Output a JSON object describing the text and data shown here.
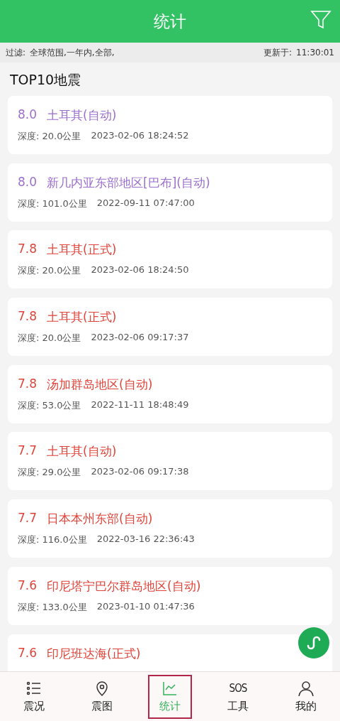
{
  "header": {
    "title": "统计"
  },
  "filter_bar": {
    "label": "过滤:",
    "value": "全球范围,一年内,全部,",
    "updated_label": "更新于:",
    "updated_time": "11:30:01"
  },
  "section_title": "TOP10地震",
  "quakes": [
    {
      "magnitude": "8.0",
      "place": "土耳其(自动)",
      "color": "#9a6fcd",
      "depth": "深度: 20.0公里",
      "time": "2023-02-06 18:24:52"
    },
    {
      "magnitude": "8.0",
      "place": "新几内亚东部地区[巴布](自动)",
      "color": "#9a6fcd",
      "depth": "深度: 101.0公里",
      "time": "2022-09-11 07:47:00"
    },
    {
      "magnitude": "7.8",
      "place": "土耳其(正式)",
      "color": "#e0443a",
      "depth": "深度: 20.0公里",
      "time": "2023-02-06 18:24:50"
    },
    {
      "magnitude": "7.8",
      "place": "土耳其(正式)",
      "color": "#e0443a",
      "depth": "深度: 20.0公里",
      "time": "2023-02-06 09:17:37"
    },
    {
      "magnitude": "7.8",
      "place": "汤加群岛地区(自动)",
      "color": "#e0443a",
      "depth": "深度: 53.0公里",
      "time": "2022-11-11 18:48:49"
    },
    {
      "magnitude": "7.7",
      "place": "土耳其(自动)",
      "color": "#e0443a",
      "depth": "深度: 29.0公里",
      "time": "2023-02-06 09:17:38"
    },
    {
      "magnitude": "7.7",
      "place": "日本本州东部(自动)",
      "color": "#e0443a",
      "depth": "深度: 116.0公里",
      "time": "2022-03-16 22:36:43"
    },
    {
      "magnitude": "7.6",
      "place": "印尼塔宁巴尔群岛地区(自动)",
      "color": "#e0443a",
      "depth": "深度: 133.0公里",
      "time": "2023-01-10 01:47:36"
    },
    {
      "magnitude": "7.6",
      "place": "印尼班达海(正式)",
      "color": "#e0443a"
    }
  ],
  "nav": [
    {
      "kind": "list",
      "label": "震况",
      "selected": false
    },
    {
      "kind": "pin",
      "label": "震图",
      "selected": false
    },
    {
      "kind": "chart",
      "label": "统计",
      "selected": true
    },
    {
      "kind": "sos",
      "label": "工具",
      "icon_text": "SOS",
      "selected": false
    },
    {
      "kind": "user",
      "label": "我的",
      "selected": false
    }
  ]
}
